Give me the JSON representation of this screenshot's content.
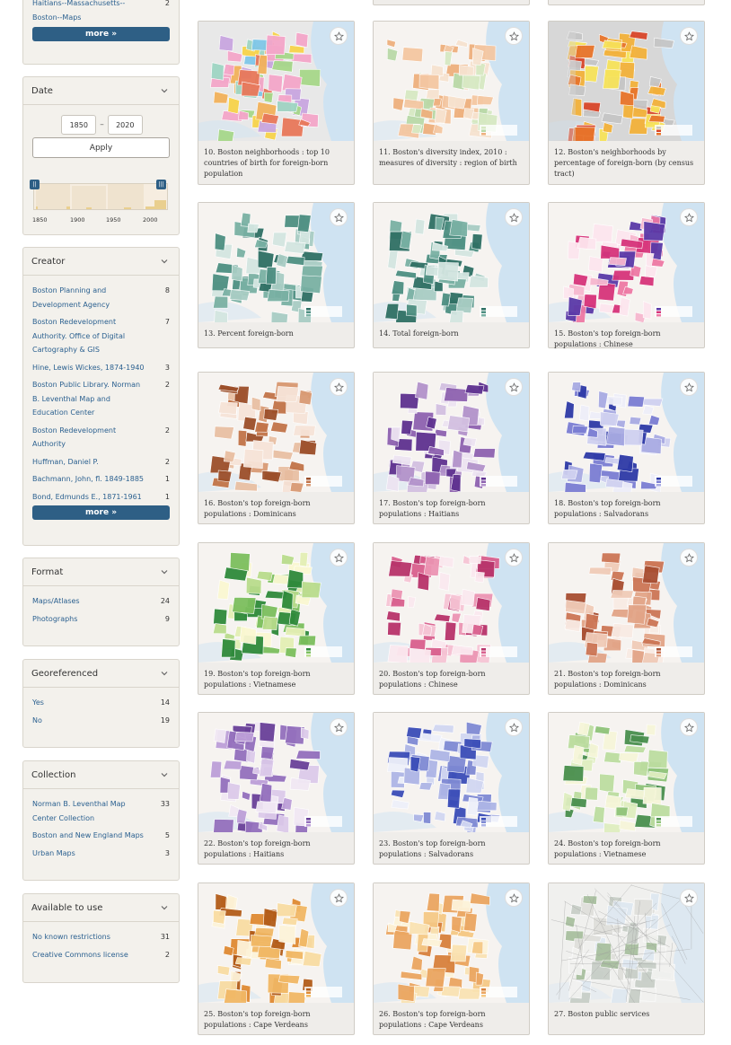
{
  "facets": {
    "top_partial": {
      "items": [
        {
          "label": "Haitians--Massachusetts--",
          "count": "2"
        },
        {
          "label": "Boston--Maps",
          "count": ""
        }
      ],
      "more_label": "more »"
    },
    "date": {
      "title": "Date",
      "from": "1850",
      "to": "2020",
      "dash": "–",
      "apply_label": "Apply",
      "axis": [
        "1850",
        "1900",
        "1950",
        "2000"
      ]
    },
    "creator": {
      "title": "Creator",
      "items": [
        {
          "label": "Boston Planning and Development Agency",
          "count": "8"
        },
        {
          "label": "Boston Redevelopment Authority. Office of Digital Cartography & GIS",
          "count": "7"
        },
        {
          "label": "Hine, Lewis Wickes, 1874-1940",
          "count": "3"
        },
        {
          "label": "Boston Public Library. Norman B. Leventhal Map and Education Center",
          "count": "2"
        },
        {
          "label": "Boston Redevelopment Authority",
          "count": "2"
        },
        {
          "label": "Huffman, Daniel P.",
          "count": "2"
        },
        {
          "label": "Bachmann, John, fl. 1849-1885",
          "count": "1"
        },
        {
          "label": "Bond, Edmunds E., 1871-1961",
          "count": "1"
        }
      ],
      "more_label": "more »"
    },
    "format": {
      "title": "Format",
      "items": [
        {
          "label": "Maps/Atlases",
          "count": "24"
        },
        {
          "label": "Photographs",
          "count": "9"
        }
      ]
    },
    "georeferenced": {
      "title": "Georeferenced",
      "items": [
        {
          "label": "Yes",
          "count": "14"
        },
        {
          "label": "No",
          "count": "19"
        }
      ]
    },
    "collection": {
      "title": "Collection",
      "items": [
        {
          "label": "Norman B. Leventhal Map Center Collection",
          "count": "33"
        },
        {
          "label": "Boston and New England Maps",
          "count": "5"
        },
        {
          "label": "Urban Maps",
          "count": "3"
        }
      ]
    },
    "available": {
      "title": "Available to use",
      "items": [
        {
          "label": "No known restrictions",
          "count": "31"
        },
        {
          "label": "Creative Commons license",
          "count": "2"
        }
      ]
    }
  },
  "results": [
    {
      "title": "10. Boston neighborhoods : top 10 countries of birth for foreign-born population",
      "palette": [
        "#f4a6c9",
        "#7fc7e8",
        "#f7d34b",
        "#a7d88a",
        "#f2b25b",
        "#c9a6e0",
        "#e8785a",
        "#9fd6c4"
      ],
      "style": "multi"
    },
    {
      "title": "11. Boston's diversity index, 2010 : measures of diversity : region of birth",
      "palette": [
        "#f7e3d0",
        "#f4c7a2",
        "#eeb07e",
        "#b9d9a8",
        "#d7e9c3"
      ],
      "style": "pale"
    },
    {
      "title": "12. Boston's neighborhoods by percentage of foreign-born (by census tract)",
      "palette": [
        "#f7e35a",
        "#f3b23b",
        "#e8752b",
        "#d9462a",
        "#c6c6c6"
      ],
      "style": "hot"
    },
    {
      "title": "13. Percent foreign-born",
      "palette": [
        "#d4e6e1",
        "#a9cdc4",
        "#7ab1a4",
        "#4e8f82",
        "#2f7064"
      ],
      "style": "teal"
    },
    {
      "title": "14. Total foreign-born",
      "palette": [
        "#d4e6e1",
        "#a9cdc4",
        "#7ab1a4",
        "#4e8f82",
        "#2f7064"
      ],
      "style": "teal"
    },
    {
      "title": "15. Boston's top foreign-born populations : Chinese",
      "palette": [
        "#fde6ee",
        "#f7b8cf",
        "#ee79a5",
        "#d7357b",
        "#5b3aa8"
      ],
      "style": "pink"
    },
    {
      "title": "16. Boston's top foreign-born populations : Dominicans",
      "palette": [
        "#f7e4d8",
        "#e9c0a4",
        "#d99b75",
        "#c27449",
        "#9c4f2a"
      ],
      "style": "brown"
    },
    {
      "title": "17. Boston's top foreign-born populations : Haitians",
      "palette": [
        "#ede4f2",
        "#d3c0e1",
        "#b393cb",
        "#8e62b0",
        "#5f3290"
      ],
      "style": "purple"
    },
    {
      "title": "18. Boston's top foreign-born populations : Salvadorans",
      "palette": [
        "#eeeef9",
        "#d0d1f0",
        "#a9abe3",
        "#7b7ed3",
        "#2e3aa7"
      ],
      "style": "blue"
    },
    {
      "title": "19. Boston's top foreign-born populations : Vietnamese",
      "palette": [
        "#fbf8d2",
        "#e4efb5",
        "#b9dc8c",
        "#7cbf5e",
        "#2f8a3b"
      ],
      "style": "green"
    },
    {
      "title": "20. Boston's top foreign-born populations : Chinese",
      "palette": [
        "#fbe9ef",
        "#f6c5d5",
        "#ec95b3",
        "#d9608e",
        "#b8346b"
      ],
      "style": "pink2"
    },
    {
      "title": "21. Boston's top foreign-born populations : Dominicans",
      "palette": [
        "#f9ebe4",
        "#f0cbb8",
        "#e2a487",
        "#cc7656",
        "#a84e32"
      ],
      "style": "brown2"
    },
    {
      "title": "22. Boston's top foreign-born populations : Haitians",
      "palette": [
        "#f1e8f4",
        "#dccaea",
        "#bd9fd8",
        "#9470bd",
        "#6a4199"
      ],
      "style": "purple2"
    },
    {
      "title": "23. Boston's top foreign-born populations : Salvadorans",
      "palette": [
        "#eef0fa",
        "#d2d7f2",
        "#aeb5e6",
        "#7f8ad4",
        "#3b4db8"
      ],
      "style": "blue2"
    },
    {
      "title": "24. Boston's top foreign-born populations : Vietnamese",
      "palette": [
        "#f6f6d9",
        "#dfeec0",
        "#bddda0",
        "#8fc379",
        "#4a8f4e"
      ],
      "style": "green2"
    },
    {
      "title": "25. Boston's top foreign-born populations : Cape Verdeans",
      "palette": [
        "#fdf3d9",
        "#f9dca3",
        "#f1b865",
        "#df8a33",
        "#b35d1a"
      ],
      "style": "orange"
    },
    {
      "title": "26. Boston's top foreign-born populations : Cape Verdeans",
      "palette": [
        "#fdf3d9",
        "#fae3b3",
        "#f5c986",
        "#eba661",
        "#d8813c"
      ],
      "style": "orange2"
    },
    {
      "title": "27. Boston public services",
      "palette": [
        "#f2f2f0",
        "#e0e0dc",
        "#c8cfc8",
        "#a9c09f",
        "#dfe8f1"
      ],
      "style": "gray"
    }
  ],
  "icons": {
    "star": "star-outline-icon",
    "chevron": "chevron-down-icon",
    "handle": "range-handle-icon"
  },
  "colors": {
    "accent": "#2e5f85",
    "link": "#2c6190",
    "panel": "#f3f1ec"
  }
}
